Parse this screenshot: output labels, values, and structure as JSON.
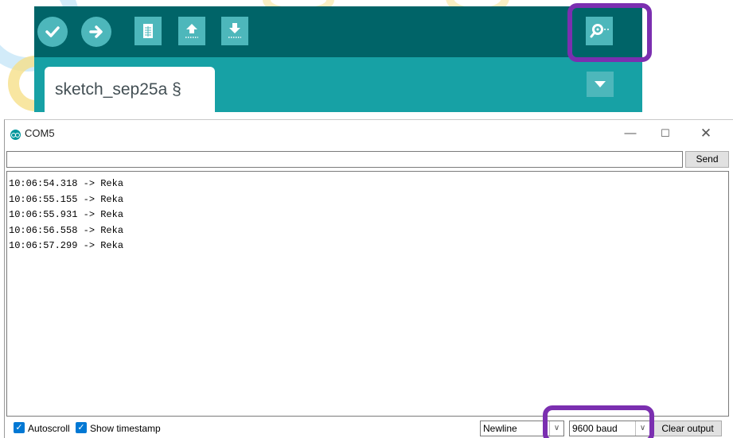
{
  "ide": {
    "tab_label": "sketch_sep25a §",
    "toolbar_icons": [
      "check-icon",
      "arrow-right-icon",
      "file-icon",
      "upload-arrow-icon",
      "download-arrow-icon",
      "magnifier-icon"
    ]
  },
  "serial_monitor": {
    "title": "COM5",
    "window_controls": {
      "minimize": "—",
      "maximize": "☐",
      "close": "✕"
    },
    "input_value": "",
    "send_label": "Send",
    "output_lines": [
      "10:06:54.318 -> Reka",
      "10:06:55.155 -> Reka",
      "10:06:55.931 -> Reka",
      "10:06:56.558 -> Reka",
      "10:06:57.299 -> Reka"
    ],
    "autoscroll_label": "Autoscroll",
    "autoscroll_checked": true,
    "timestamp_label": "Show timestamp",
    "timestamp_checked": true,
    "line_ending": "Newline",
    "baud_rate": "9600 baud",
    "clear_label": "Clear output"
  },
  "colors": {
    "toolbar": "#006468",
    "tabbar": "#17a1a5",
    "button": "#4db7bb",
    "highlight": "#7b2fb0",
    "checkbox": "#0078d4"
  }
}
